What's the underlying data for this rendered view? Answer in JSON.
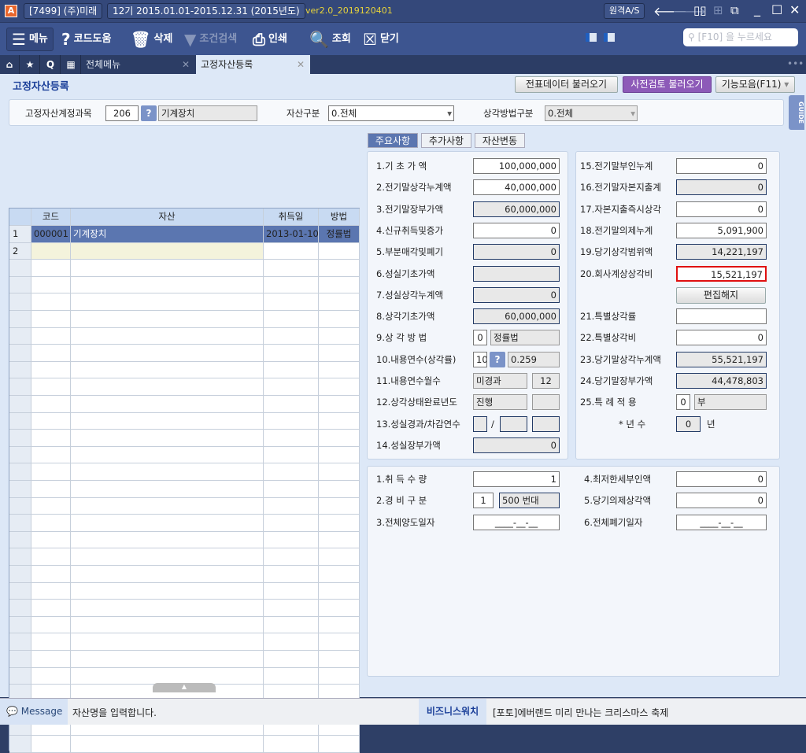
{
  "titlebar": {
    "company": "[7499] (주)미래",
    "period": "12기 2015.01.01-2015.12.31 (2015년도)",
    "version": "ver2.0_2019120401",
    "remote": "원격A/S"
  },
  "toolbar": {
    "menu": "메뉴",
    "code_help": "코드도움",
    "delete": "삭제",
    "filter": "조건검색",
    "print": "인쇄",
    "search": "조회",
    "close": "닫기",
    "search_placeholder": "[F10] 을 누르세요"
  },
  "tabs": [
    {
      "label": "전체메뉴"
    },
    {
      "label": "고정자산등록"
    }
  ],
  "page": {
    "title": "고정자산등록",
    "btn_voucher": "전표데이터 불러오기",
    "btn_precheck": "사전검토 불러오기",
    "btn_functions": "기능모음(F11)",
    "guide": "GUIDE"
  },
  "filters": {
    "account_label": "고정자산계정과목",
    "account_code": "206",
    "account_name": "기계장치",
    "asset_type_label": "자산구분",
    "asset_type": "0.전체",
    "method_label": "상각방법구분",
    "method": "0.전체"
  },
  "grid": {
    "headers": [
      "코드",
      "자산",
      "취득일",
      "방법"
    ],
    "rows": [
      {
        "num": "1",
        "code": "000001",
        "asset": "기계장치",
        "date": "2013-01-10",
        "method": "정률법"
      },
      {
        "num": "2",
        "code": "",
        "asset": "",
        "date": "",
        "method": ""
      }
    ]
  },
  "detail_tabs": [
    "주요사항",
    "추가사항",
    "자산변동"
  ],
  "left_fields": [
    {
      "label": "1.기  초  가  액",
      "value": "100,000,000",
      "ro": false
    },
    {
      "label": "2.전기말상각누계액",
      "value": "40,000,000",
      "ro": false
    },
    {
      "label": "3.전기말장부가액",
      "value": "60,000,000",
      "ro": true
    },
    {
      "label": "4.신규취득및증가",
      "value": "0",
      "ro": false
    },
    {
      "label": "5.부분매각및폐기",
      "value": "0",
      "ro": true
    },
    {
      "label": "6.성실기초가액",
      "value": "",
      "ro": true
    },
    {
      "label": "7.성실상각누계액",
      "value": "0",
      "ro": true
    },
    {
      "label": "8.상각기초가액",
      "value": "60,000,000",
      "ro": true
    },
    {
      "label": "9.상  각  방  법",
      "code": "0",
      "value": "정률법"
    },
    {
      "label": "10.내용연수(상각률)",
      "code": "10",
      "value": "0.259"
    },
    {
      "label": "11.내용연수월수",
      "value": "미경과",
      "extra": "12"
    },
    {
      "label": "12.상각상태완료년도",
      "value": "진행",
      "extra": ""
    },
    {
      "label": "13.성실경과/차감연수",
      "sep": "/"
    },
    {
      "label": "14.성실장부가액",
      "value": "0",
      "ro": true
    }
  ],
  "right_fields": [
    {
      "label": "15.전기말부인누계",
      "value": "0",
      "ro": false
    },
    {
      "label": "16.전기말자본지출계",
      "value": "0",
      "ro": true
    },
    {
      "label": "17.자본지출즉시상각",
      "value": "0",
      "ro": false
    },
    {
      "label": "18.전기말의제누계",
      "value": "5,091,900",
      "ro": false
    },
    {
      "label": "19.당기상각범위액",
      "value": "14,221,197",
      "ro": true
    },
    {
      "label": "20.회사계상상각비",
      "value": "15,521,197",
      "ro": false,
      "highlight": true
    },
    {
      "button": "편집해지"
    },
    {
      "label": "21.특별상각률",
      "value": "",
      "ro": false
    },
    {
      "label": "22.특별상각비",
      "value": "0",
      "ro": false
    },
    {
      "label": "23.당기말상각누계액",
      "value": "55,521,197",
      "ro": true
    },
    {
      "label": "24.당기말장부가액",
      "value": "44,478,803",
      "ro": true
    },
    {
      "label": "25.특  례  적  용",
      "code": "0",
      "value": "부"
    },
    {
      "label": "*  년  수",
      "value": "0",
      "unit": "년"
    }
  ],
  "bottom_fields": [
    {
      "label": "1.취  득  수  량",
      "value": "1"
    },
    {
      "label": "2.경  비  구  분",
      "code": "1",
      "value": "500 번대"
    },
    {
      "label": "3.전체양도일자",
      "value": "____-__-__"
    },
    {
      "label": "4.최저한세부인액",
      "value": "0"
    },
    {
      "label": "5.당기의제상각액",
      "value": "0"
    },
    {
      "label": "6.전체폐기일자",
      "value": "____-__-__"
    }
  ],
  "status": {
    "message_label": "Message",
    "message": "자산명을 입력합니다.",
    "news_label": "비즈니스워치",
    "news": "[포토]에버랜드 미리 만나는 크리스마스 축제"
  }
}
